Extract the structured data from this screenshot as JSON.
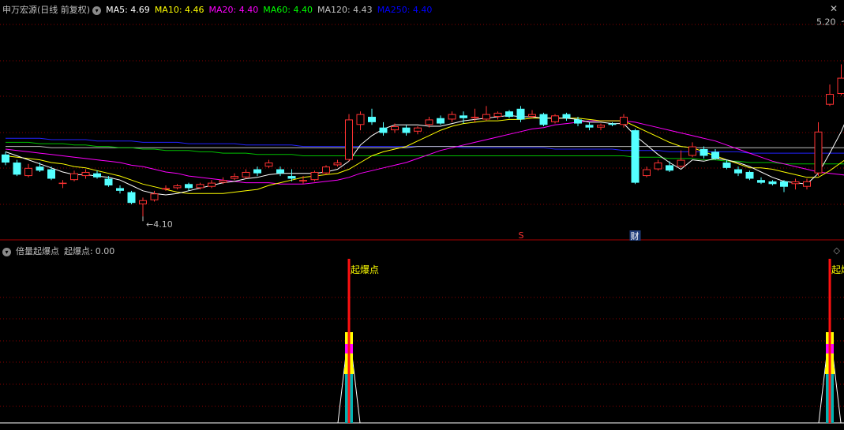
{
  "main_header": {
    "stock": "申万宏源",
    "period": "(日线 前复权)",
    "ma": [
      {
        "label": "MA5:",
        "value": "4.69",
        "color": "#ffffff"
      },
      {
        "label": "MA10:",
        "value": "4.46",
        "color": "#ffff00"
      },
      {
        "label": "MA20:",
        "value": "4.40",
        "color": "#ff00ff"
      },
      {
        "label": "MA60:",
        "value": "4.40",
        "color": "#00ff00"
      },
      {
        "label": "MA120:",
        "value": "4.43",
        "color": "#c0c0c0"
      },
      {
        "label": "MA250:",
        "value": "4.40",
        "color": "#0000ff"
      }
    ]
  },
  "main_chart": {
    "high_label": "5.20",
    "low_label": "4.10",
    "marker_s": "S",
    "marker_cai": "财"
  },
  "indicator_header": {
    "name": "倍量起爆点",
    "value_label": "起爆点:",
    "value": "0.00"
  },
  "indicator": {
    "signal_label": "起爆点"
  },
  "colors": {
    "up": "#ff3232",
    "down": "#54ffff",
    "grid": "#8b0000",
    "background": "#000000"
  },
  "chart_data": {
    "type": "candlestick",
    "candles": [
      [
        4.56,
        4.5,
        4.58,
        4.48
      ],
      [
        4.5,
        4.41,
        4.52,
        4.4
      ],
      [
        4.4,
        4.46,
        4.49,
        4.39
      ],
      [
        4.47,
        4.44,
        4.5,
        4.43
      ],
      [
        4.45,
        4.38,
        4.47,
        4.37
      ],
      [
        4.35,
        4.35,
        4.37,
        4.31
      ],
      [
        4.37,
        4.42,
        4.44,
        4.36
      ],
      [
        4.4,
        4.43,
        4.45,
        4.38
      ],
      [
        4.42,
        4.39,
        4.44,
        4.38
      ],
      [
        4.38,
        4.33,
        4.4,
        4.32
      ],
      [
        4.31,
        4.29,
        4.33,
        4.27
      ],
      [
        4.28,
        4.2,
        4.29,
        4.19
      ],
      [
        4.19,
        4.22,
        4.24,
        4.1
      ],
      [
        4.22,
        4.27,
        4.29,
        4.21
      ],
      [
        4.3,
        4.31,
        4.33,
        4.29
      ],
      [
        4.31,
        4.33,
        4.34,
        4.3
      ],
      [
        4.34,
        4.31,
        4.35,
        4.29
      ],
      [
        4.31,
        4.34,
        4.35,
        4.3
      ],
      [
        4.32,
        4.35,
        4.37,
        4.31
      ],
      [
        4.35,
        4.37,
        4.39,
        4.34
      ],
      [
        4.38,
        4.4,
        4.42,
        4.37
      ],
      [
        4.39,
        4.43,
        4.45,
        4.38
      ],
      [
        4.45,
        4.42,
        4.47,
        4.4
      ],
      [
        4.47,
        4.5,
        4.52,
        4.46
      ],
      [
        4.45,
        4.42,
        4.47,
        4.4
      ],
      [
        4.4,
        4.38,
        4.45,
        4.36
      ],
      [
        4.36,
        4.37,
        4.4,
        4.34
      ],
      [
        4.37,
        4.43,
        4.44,
        4.36
      ],
      [
        4.42,
        4.47,
        4.48,
        4.41
      ],
      [
        4.48,
        4.5,
        4.52,
        4.47
      ],
      [
        4.52,
        4.82,
        4.86,
        4.51
      ],
      [
        4.78,
        4.86,
        4.88,
        4.74
      ],
      [
        4.84,
        4.8,
        4.9,
        4.78
      ],
      [
        4.76,
        4.72,
        4.8,
        4.7
      ],
      [
        4.74,
        4.77,
        4.79,
        4.72
      ],
      [
        4.76,
        4.72,
        4.78,
        4.7
      ],
      [
        4.73,
        4.76,
        4.77,
        4.71
      ],
      [
        4.78,
        4.82,
        4.84,
        4.76
      ],
      [
        4.83,
        4.79,
        4.85,
        4.78
      ],
      [
        4.82,
        4.86,
        4.88,
        4.8
      ],
      [
        4.85,
        4.83,
        4.88,
        4.79
      ],
      [
        4.83,
        4.84,
        4.9,
        4.8
      ],
      [
        4.82,
        4.86,
        4.92,
        4.81
      ],
      [
        4.84,
        4.87,
        4.88,
        4.82
      ],
      [
        4.88,
        4.84,
        4.89,
        4.83
      ],
      [
        4.9,
        4.82,
        4.92,
        4.8
      ],
      [
        4.84,
        4.86,
        4.89,
        4.83
      ],
      [
        4.86,
        4.78,
        4.87,
        4.77
      ],
      [
        4.8,
        4.85,
        4.86,
        4.79
      ],
      [
        4.86,
        4.83,
        4.87,
        4.81
      ],
      [
        4.82,
        4.79,
        4.84,
        4.77
      ],
      [
        4.78,
        4.76,
        4.8,
        4.74
      ],
      [
        4.76,
        4.78,
        4.79,
        4.74
      ],
      [
        4.79,
        4.78,
        4.8,
        4.77
      ],
      [
        4.78,
        4.84,
        4.86,
        4.76
      ],
      [
        4.74,
        4.35,
        4.75,
        4.34
      ],
      [
        4.4,
        4.45,
        4.47,
        4.39
      ],
      [
        4.45,
        4.5,
        4.52,
        4.44
      ],
      [
        4.48,
        4.44,
        4.51,
        4.43
      ],
      [
        4.47,
        4.52,
        4.59,
        4.46
      ],
      [
        4.55,
        4.62,
        4.65,
        4.54
      ],
      [
        4.6,
        4.55,
        4.62,
        4.53
      ],
      [
        4.58,
        4.53,
        4.6,
        4.52
      ],
      [
        4.5,
        4.46,
        4.52,
        4.45
      ],
      [
        4.45,
        4.42,
        4.47,
        4.4
      ],
      [
        4.43,
        4.38,
        4.44,
        4.37
      ],
      [
        4.37,
        4.35,
        4.39,
        4.34
      ],
      [
        4.36,
        4.34,
        4.37,
        4.33
      ],
      [
        4.36,
        4.32,
        4.37,
        4.28
      ],
      [
        4.34,
        4.36,
        4.38,
        4.3
      ],
      [
        4.32,
        4.36,
        4.38,
        4.3
      ],
      [
        4.42,
        4.73,
        4.8,
        4.4
      ],
      [
        4.93,
        5.01,
        5.08,
        4.92
      ],
      [
        5.01,
        5.13,
        5.23,
        5.0
      ],
      [
        5.28,
        5.5,
        5.57,
        5.26
      ]
    ],
    "ma5": [
      4.58,
      4.55,
      4.52,
      4.49,
      4.46,
      4.43,
      4.41,
      4.41,
      4.4,
      4.39,
      4.37,
      4.33,
      4.29,
      4.27,
      4.26,
      4.27,
      4.29,
      4.31,
      4.33,
      4.35,
      4.36,
      4.38,
      4.39,
      4.41,
      4.42,
      4.42,
      4.42,
      4.42,
      4.43,
      4.45,
      4.51,
      4.63,
      4.7,
      4.75,
      4.78,
      4.78,
      4.78,
      4.77,
      4.77,
      4.79,
      4.81,
      4.82,
      4.83,
      4.84,
      4.85,
      4.84,
      4.84,
      4.83,
      4.83,
      4.83,
      4.82,
      4.8,
      4.8,
      4.79,
      4.79,
      4.7,
      4.63,
      4.56,
      4.5,
      4.45,
      4.52,
      4.51,
      4.53,
      4.52,
      4.5,
      4.47,
      4.43,
      4.39,
      4.36,
      4.35,
      4.34,
      4.42,
      4.57,
      4.73,
      4.93
    ],
    "ma10": [
      4.55,
      4.54,
      4.53,
      4.52,
      4.5,
      4.49,
      4.47,
      4.46,
      4.44,
      4.42,
      4.4,
      4.37,
      4.34,
      4.32,
      4.3,
      4.28,
      4.27,
      4.27,
      4.27,
      4.27,
      4.28,
      4.29,
      4.3,
      4.33,
      4.35,
      4.37,
      4.39,
      4.4,
      4.41,
      4.42,
      4.45,
      4.5,
      4.55,
      4.58,
      4.6,
      4.62,
      4.66,
      4.7,
      4.74,
      4.77,
      4.79,
      4.8,
      4.81,
      4.81,
      4.82,
      4.82,
      4.83,
      4.83,
      4.83,
      4.83,
      4.83,
      4.82,
      4.81,
      4.81,
      4.81,
      4.77,
      4.73,
      4.69,
      4.65,
      4.62,
      4.61,
      4.58,
      4.55,
      4.52,
      4.49,
      4.46,
      4.46,
      4.45,
      4.43,
      4.41,
      4.39,
      4.39,
      4.44,
      4.5,
      4.56
    ],
    "ma20": [
      4.6,
      4.59,
      4.58,
      4.57,
      4.56,
      4.55,
      4.54,
      4.53,
      4.52,
      4.51,
      4.5,
      4.48,
      4.47,
      4.45,
      4.43,
      4.42,
      4.4,
      4.39,
      4.38,
      4.37,
      4.36,
      4.35,
      4.35,
      4.35,
      4.34,
      4.34,
      4.34,
      4.35,
      4.36,
      4.37,
      4.39,
      4.42,
      4.44,
      4.46,
      4.48,
      4.5,
      4.53,
      4.56,
      4.59,
      4.61,
      4.63,
      4.65,
      4.67,
      4.69,
      4.71,
      4.73,
      4.75,
      4.76,
      4.78,
      4.79,
      4.8,
      4.81,
      4.81,
      4.81,
      4.81,
      4.8,
      4.78,
      4.76,
      4.74,
      4.72,
      4.7,
      4.68,
      4.66,
      4.63,
      4.6,
      4.57,
      4.54,
      4.51,
      4.49,
      4.47,
      4.45,
      4.43,
      4.42,
      4.41,
      4.4
    ],
    "ma60": [
      4.65,
      4.65,
      4.65,
      4.64,
      4.64,
      4.64,
      4.63,
      4.63,
      4.62,
      4.62,
      4.61,
      4.61,
      4.6,
      4.6,
      4.59,
      4.59,
      4.59,
      4.58,
      4.58,
      4.57,
      4.57,
      4.57,
      4.56,
      4.56,
      4.56,
      4.56,
      4.55,
      4.55,
      4.55,
      4.55,
      4.55,
      4.55,
      4.55,
      4.55,
      4.55,
      4.55,
      4.55,
      4.55,
      4.55,
      4.55,
      4.55,
      4.55,
      4.55,
      4.55,
      4.55,
      4.55,
      4.55,
      4.55,
      4.55,
      4.55,
      4.55,
      4.55,
      4.55,
      4.55,
      4.55,
      4.54,
      4.54,
      4.54,
      4.53,
      4.53,
      4.53,
      4.52,
      4.52,
      4.51,
      4.51,
      4.5,
      4.5,
      4.5,
      4.49,
      4.49,
      4.49,
      4.49,
      4.49,
      4.49,
      4.49
    ],
    "ma120": [
      4.62,
      4.62,
      4.62,
      4.62,
      4.61,
      4.61,
      4.61,
      4.61,
      4.61,
      4.61,
      4.61,
      4.61,
      4.61,
      4.61,
      4.61,
      4.61,
      4.61,
      4.61,
      4.61,
      4.61,
      4.61,
      4.61,
      4.61,
      4.61,
      4.61,
      4.61,
      4.61,
      4.61,
      4.61,
      4.61,
      4.61,
      4.61,
      4.61,
      4.61,
      4.61,
      4.61,
      4.62,
      4.62,
      4.62,
      4.62,
      4.62,
      4.62,
      4.62,
      4.62,
      4.62,
      4.62,
      4.62,
      4.62,
      4.62,
      4.62,
      4.62,
      4.62,
      4.62,
      4.62,
      4.62,
      4.62,
      4.62,
      4.62,
      4.62,
      4.62,
      4.61,
      4.61,
      4.61,
      4.61,
      4.61,
      4.61,
      4.61,
      4.61,
      4.61,
      4.61,
      4.61,
      4.61,
      4.61,
      4.61,
      4.61
    ],
    "ma250": [
      4.68,
      4.68,
      4.68,
      4.68,
      4.67,
      4.67,
      4.67,
      4.67,
      4.66,
      4.66,
      4.66,
      4.66,
      4.65,
      4.65,
      4.65,
      4.65,
      4.64,
      4.64,
      4.64,
      4.64,
      4.64,
      4.63,
      4.63,
      4.63,
      4.63,
      4.63,
      4.62,
      4.62,
      4.62,
      4.62,
      4.62,
      4.62,
      4.62,
      4.62,
      4.62,
      4.62,
      4.62,
      4.62,
      4.62,
      4.62,
      4.61,
      4.61,
      4.61,
      4.61,
      4.61,
      4.61,
      4.61,
      4.61,
      4.6,
      4.6,
      4.6,
      4.6,
      4.6,
      4.6,
      4.59,
      4.59,
      4.59,
      4.59,
      4.58,
      4.58,
      4.58,
      4.58,
      4.58,
      4.58,
      4.58,
      4.57,
      4.57,
      4.57,
      4.57,
      4.57,
      4.57,
      4.57,
      4.57,
      4.57,
      4.57
    ],
    "signals": [
      30,
      72
    ],
    "s_marker_index": 45,
    "cai_marker_index": 55
  }
}
